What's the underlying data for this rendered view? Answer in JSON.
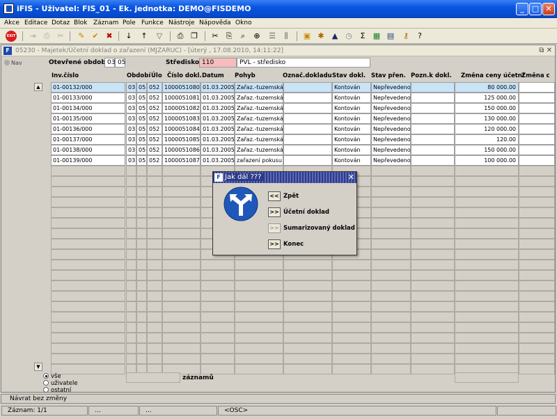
{
  "window": {
    "title": "iFIS - Uživatel: FIS_01 - Ek. jednotka: DEMO@FISDEMO"
  },
  "menu": [
    "Akce",
    "Editace",
    "Dotaz",
    "Blok",
    "Záznam",
    "Pole",
    "Funkce",
    "Nástroje",
    "Nápověda",
    "Okno"
  ],
  "toolbar": {
    "exit_label": "EXIT"
  },
  "form": {
    "title": "05230 - Majetek/Účetní doklad o zařazení (MJZARUC) - [úterý , 17.08.2010, 14:11:22]",
    "nav_label": "Nav",
    "period_label": "Otevřené období",
    "period_a": "03",
    "period_b": "05",
    "center_label": "Středisko",
    "center_code": "110",
    "center_name": "PVL - středisko"
  },
  "grid": {
    "headers": [
      "Inv.číslo",
      "Období",
      "Úlo",
      "Číslo dokl.",
      "Datum",
      "Pohyb",
      "Označ.dokladu",
      "Stav dokl.",
      "Stav přen.",
      "Pozn.k dokl.",
      "Změna ceny účetní",
      "Změna c"
    ],
    "rows": [
      [
        "01-00132/000",
        "03",
        "05",
        "052",
        "1000051080",
        "01.03.2005",
        "Zařaz.-tuzemská",
        "",
        "Kontován",
        "Nepřevedeno",
        "",
        "80 000.00"
      ],
      [
        "01-00133/000",
        "03",
        "05",
        "052",
        "1000051081",
        "01.03.2005",
        "Zařaz.-tuzemská",
        "",
        "Kontován",
        "Nepřevedeno",
        "",
        "125 000.00"
      ],
      [
        "01-00134/000",
        "03",
        "05",
        "052",
        "1000051082",
        "01.03.2005",
        "Zařaz.-tuzemská",
        "",
        "Kontován",
        "Nepřevedeno",
        "",
        "150 000.00"
      ],
      [
        "01-00135/000",
        "03",
        "05",
        "052",
        "1000051083",
        "01.03.2005",
        "Zařaz.-tuzemská",
        "",
        "Kontován",
        "Nepřevedeno",
        "",
        "130 000.00"
      ],
      [
        "01-00136/000",
        "03",
        "05",
        "052",
        "1000051084",
        "01.03.2005",
        "Zařaz.-tuzemská",
        "",
        "Kontován",
        "Nepřevedeno",
        "",
        "120 000.00"
      ],
      [
        "01-00137/000",
        "03",
        "05",
        "052",
        "1000051085",
        "01.03.2005",
        "Zařaz.-tuzemská",
        "",
        "Kontován",
        "Nepřevedeno",
        "",
        "120.00"
      ],
      [
        "01-00138/000",
        "03",
        "05",
        "052",
        "1000051086",
        "01.03.2005",
        "Zařaz.-tuzemská",
        "",
        "Kontován",
        "Nepřevedeno",
        "",
        "150 000.00"
      ],
      [
        "01-00139/000",
        "03",
        "05",
        "052",
        "1000051087",
        "01.03.2005",
        "zařazení pokusu",
        "",
        "Kontován",
        "Nepřevedeno",
        "",
        "100 000.00"
      ]
    ],
    "records_label": "záznamů"
  },
  "filter": {
    "options": [
      "vše",
      "uživatele",
      "ostatní"
    ],
    "selected": "vše"
  },
  "dialog": {
    "title": "Jak dál ???",
    "buttons": [
      {
        "symbol": "<<",
        "label": "Zpět",
        "enabled": true
      },
      {
        "symbol": ">>",
        "label": "Účetní doklad",
        "enabled": true
      },
      {
        "symbol": ">>",
        "label": "Sumarizovaný doklad",
        "enabled": false
      },
      {
        "symbol": ">>",
        "label": "Konec",
        "enabled": true
      }
    ]
  },
  "status": {
    "message": "Návrat bez změny",
    "record": "Záznam: 1/1",
    "seg2": "...",
    "seg3": "...",
    "mode": "<OSC>"
  },
  "colors": {
    "titlebar": "#0a56e0",
    "selected_row": "#c9e3f7",
    "pink_field": "#f8bcbc",
    "dialog_title": "#2d3b88"
  }
}
